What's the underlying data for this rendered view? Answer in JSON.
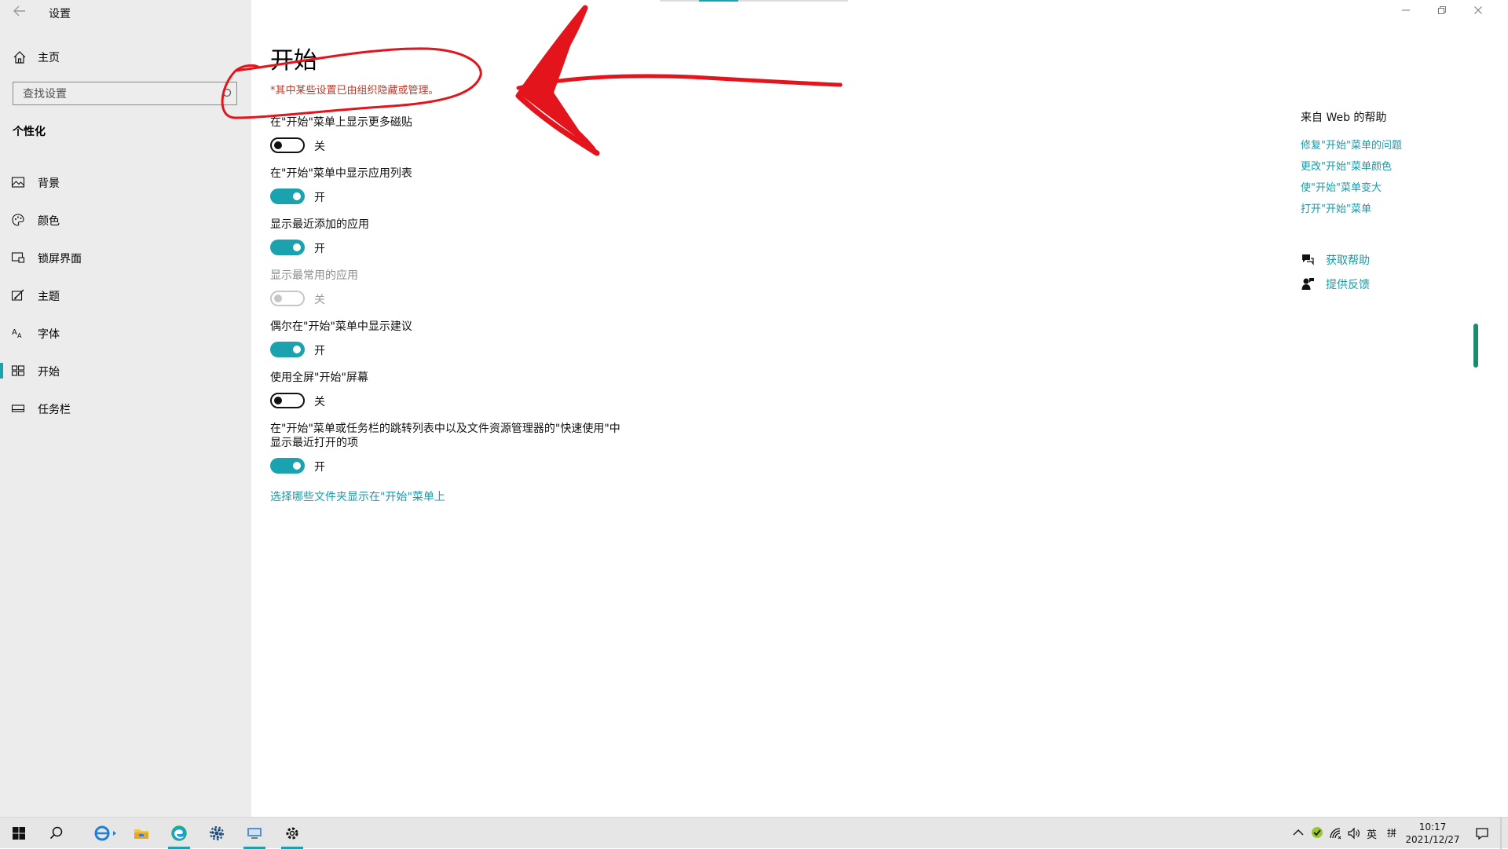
{
  "window": {
    "title": "设置"
  },
  "sidebar": {
    "home_label": "主页",
    "search_placeholder": "查找设置",
    "section_title": "个性化",
    "items": [
      {
        "label": "背景",
        "icon": "image-icon"
      },
      {
        "label": "颜色",
        "icon": "palette-icon"
      },
      {
        "label": "锁屏界面",
        "icon": "lock-screen-icon"
      },
      {
        "label": "主题",
        "icon": "theme-brush-icon"
      },
      {
        "label": "字体",
        "icon": "font-icon"
      },
      {
        "label": "开始",
        "icon": "start-tiles-icon",
        "active": true
      },
      {
        "label": "任务栏",
        "icon": "taskbar-icon"
      }
    ]
  },
  "main": {
    "title": "开始",
    "notice": "*其中某些设置已由组织隐藏或管理。",
    "settings": [
      {
        "label": "在\"开始\"菜单上显示更多磁贴",
        "state": "关",
        "on": false,
        "disabled": false
      },
      {
        "label": "在\"开始\"菜单中显示应用列表",
        "state": "开",
        "on": true,
        "disabled": false
      },
      {
        "label": "显示最近添加的应用",
        "state": "开",
        "on": true,
        "disabled": false
      },
      {
        "label": "显示最常用的应用",
        "state": "关",
        "on": false,
        "disabled": true
      },
      {
        "label": "偶尔在\"开始\"菜单中显示建议",
        "state": "开",
        "on": true,
        "disabled": false
      },
      {
        "label": "使用全屏\"开始\"屏幕",
        "state": "关",
        "on": false,
        "disabled": false
      },
      {
        "label": "在\"开始\"菜单或任务栏的跳转列表中以及文件资源管理器的\"快速使用\"中显示最近打开的项",
        "state": "开",
        "on": true,
        "disabled": false
      }
    ],
    "folders_link": "选择哪些文件夹显示在\"开始\"菜单上"
  },
  "help": {
    "title": "来自 Web 的帮助",
    "links": [
      "修复\"开始\"菜单的问题",
      "更改\"开始\"菜单颜色",
      "使\"开始\"菜单变大",
      "打开\"开始\"菜单"
    ],
    "get_help": "获取帮助",
    "feedback": "提供反馈"
  },
  "taskbar": {
    "ime": "英",
    "ime_mode": "拼",
    "time": "10:17",
    "date": "2021/12/27"
  },
  "colors": {
    "accent": "#1aa3ae",
    "notice": "#c0392b",
    "annotation": "#e3141c"
  }
}
